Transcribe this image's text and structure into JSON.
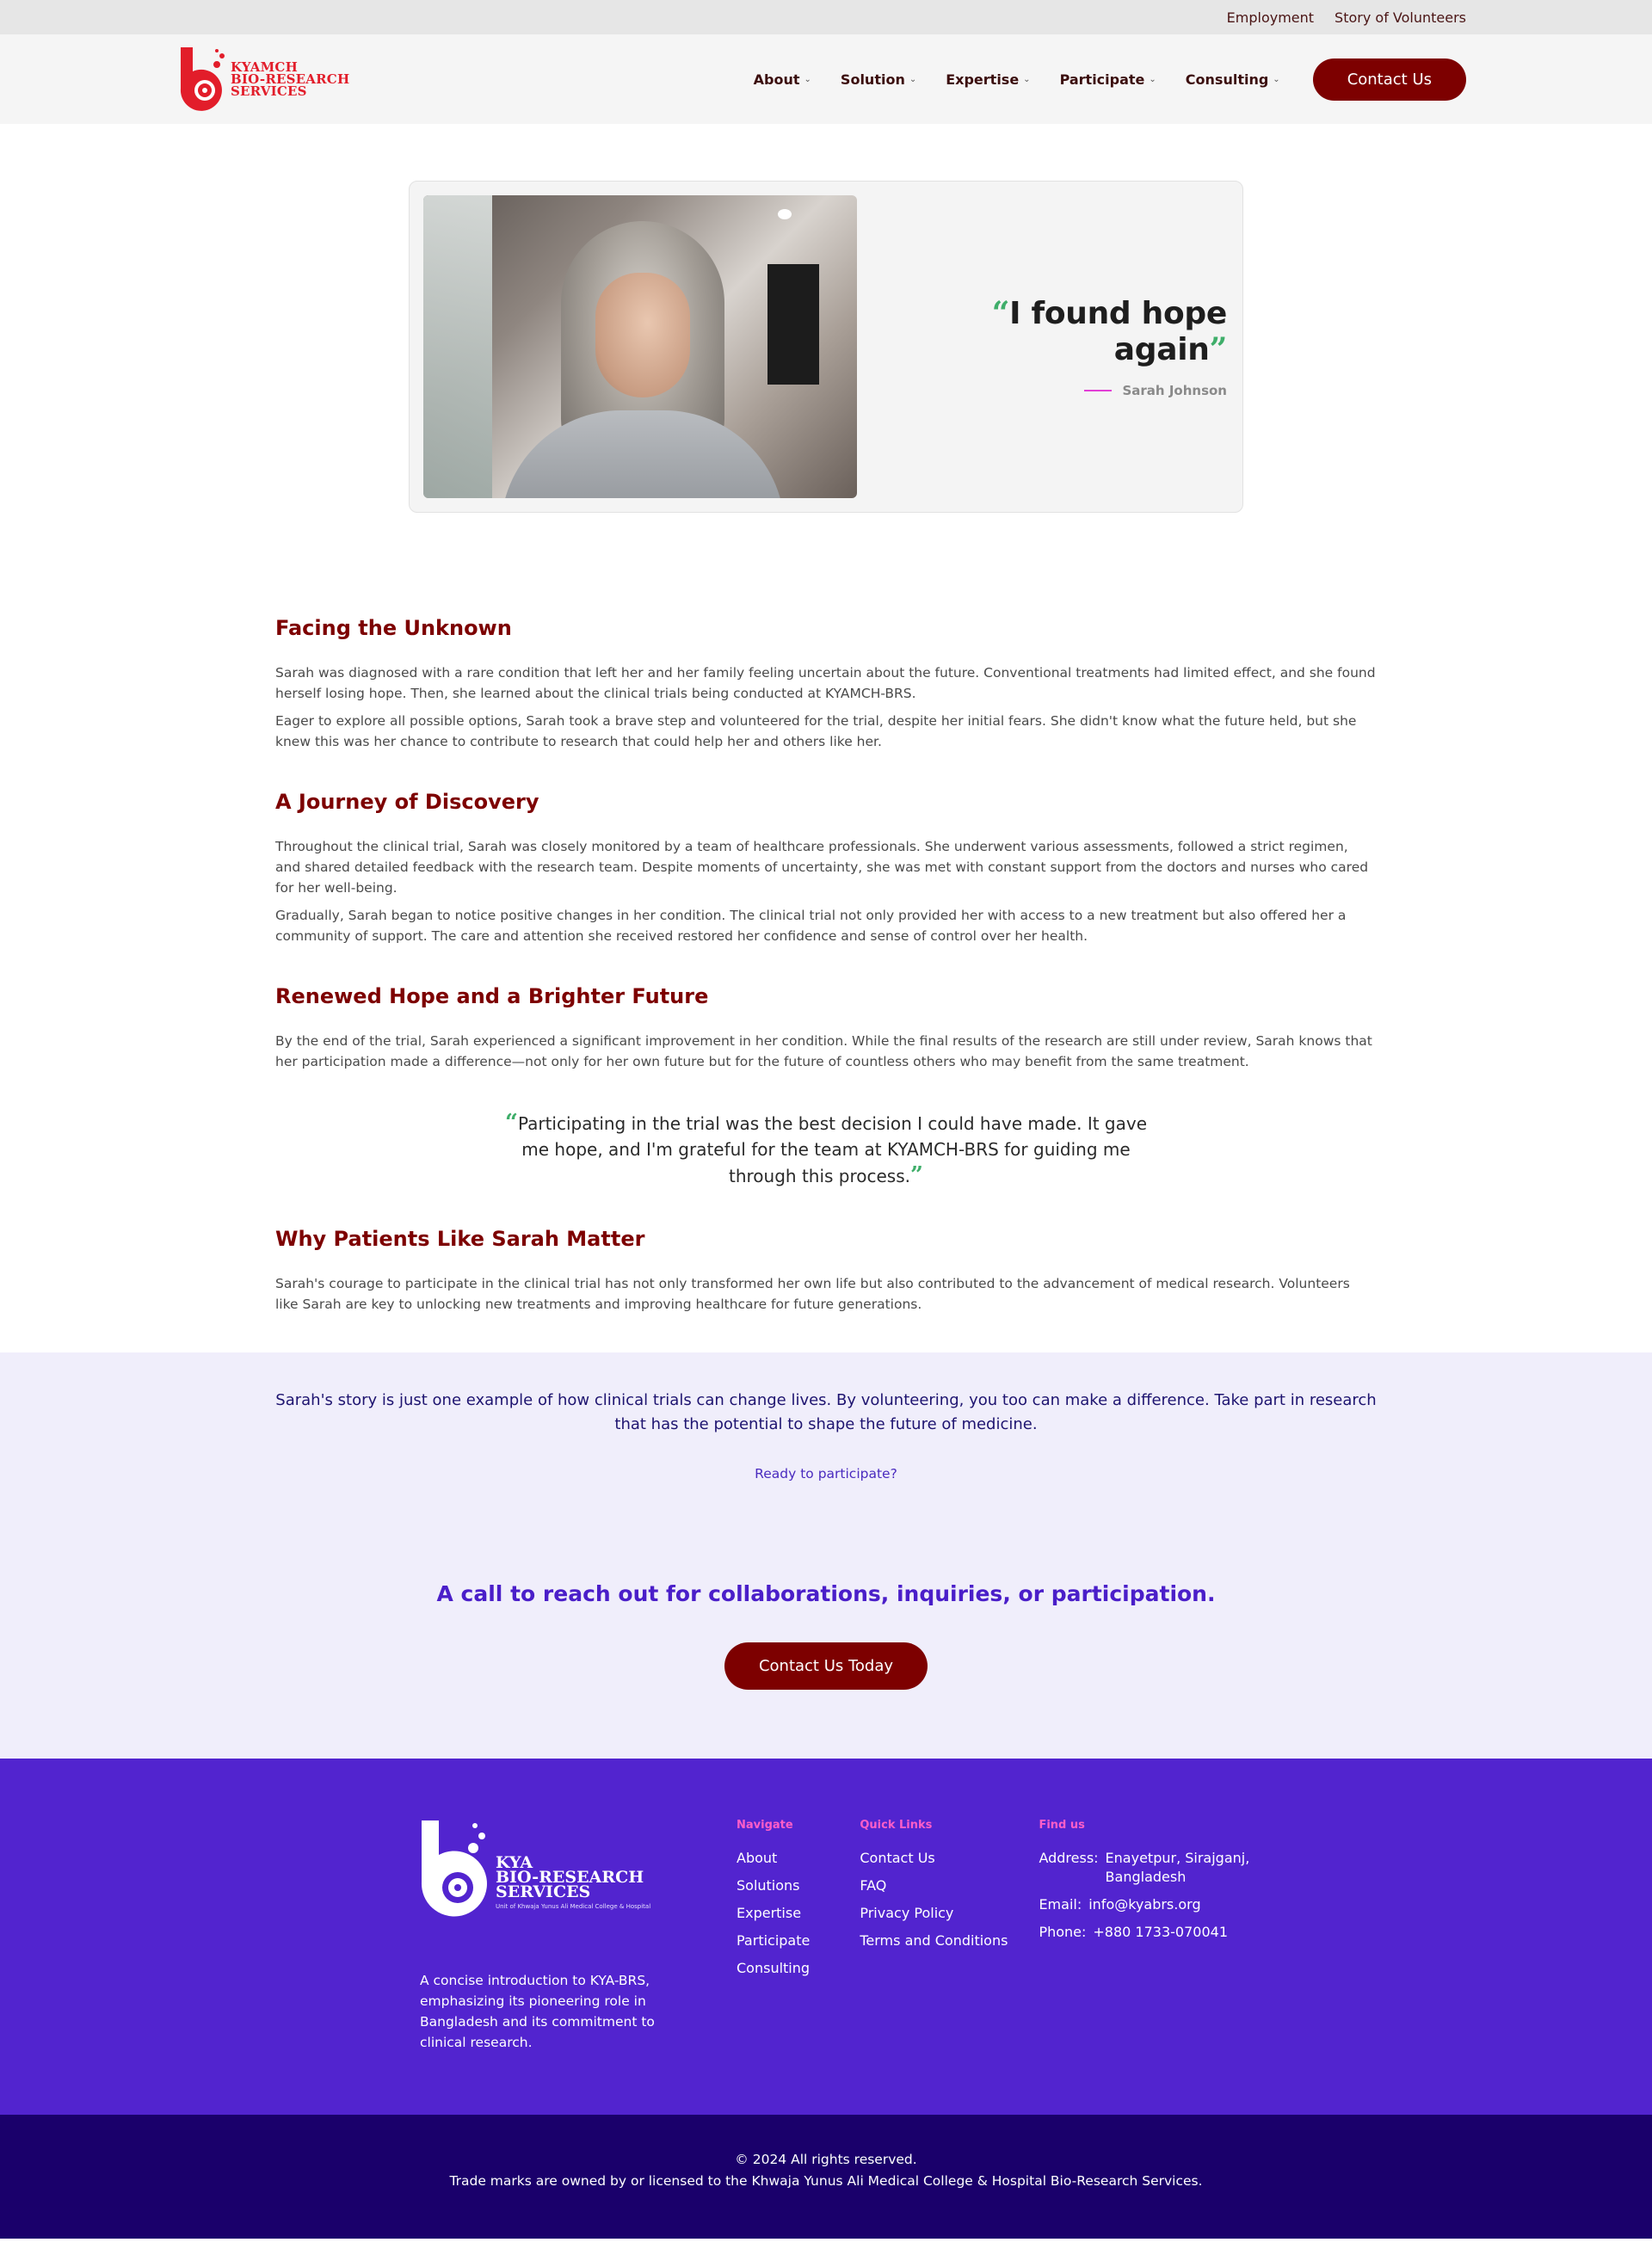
{
  "topbar": {
    "links": [
      "Employment",
      "Story of Volunteers"
    ]
  },
  "header": {
    "logo_lines": [
      "KYAMCH",
      "BIO-RESEARCH",
      "SERVICES"
    ],
    "nav": [
      {
        "label": "About"
      },
      {
        "label": "Solution"
      },
      {
        "label": "Expertise"
      },
      {
        "label": "Participate"
      },
      {
        "label": "Consulting"
      }
    ],
    "contact_label": "Contact Us"
  },
  "hero": {
    "quote": "I found hope again",
    "author": "Sarah Johnson"
  },
  "article": {
    "sections": [
      {
        "heading": "Facing the Unknown",
        "paragraphs": [
          "Sarah was diagnosed with a rare condition that left her and her family feeling uncertain about the future. Conventional treatments had limited effect, and she found herself losing hope. Then, she learned about the clinical trials being conducted at KYAMCH-BRS.",
          "Eager to explore all possible options, Sarah took a brave step and volunteered for the trial, despite her initial fears. She didn't know what the future held, but she knew this was her chance to contribute to research that could help her and others like her."
        ]
      },
      {
        "heading": "A Journey of Discovery",
        "paragraphs": [
          "Throughout the clinical trial, Sarah was closely monitored by a team of healthcare professionals. She underwent various assessments, followed a strict regimen, and shared detailed feedback with the research team. Despite moments of uncertainty, she was met with constant support from the doctors and nurses who cared for her well-being.",
          "Gradually, Sarah began to notice positive changes in her condition. The clinical trial not only provided her with access to a new treatment but also offered her a community of support. The care and attention she received restored her confidence and sense of control over her health."
        ]
      },
      {
        "heading": "Renewed Hope and a Brighter Future",
        "paragraphs": [
          "By the end of the trial, Sarah experienced a significant improvement in her condition. While the final results of the research are still under review, Sarah knows that her participation made a difference—not only for her own future but for the future of countless others who may benefit from the same treatment."
        ]
      }
    ],
    "pull_quote": "Participating in the trial was the best decision I could have made. It gave me hope, and I'm grateful for the team at KYAMCH-BRS for guiding me through this process.",
    "final_section": {
      "heading": "Why Patients Like Sarah Matter",
      "paragraphs": [
        "Sarah's courage to participate in the clinical trial has not only transformed her own life but also contributed to the advancement of medical research. Volunteers like Sarah are key to unlocking new treatments and improving healthcare for future generations."
      ]
    }
  },
  "cta": {
    "text": "Sarah's story is just one example of how clinical trials can change lives. By volunteering, you too can make a difference. Take part in research that has the potential to shape the future of medicine.",
    "link": "Ready to participate?",
    "heading": "A call to reach out for collaborations, inquiries, or participation.",
    "button": "Contact Us Today"
  },
  "footer": {
    "logo_lines": [
      "KYA",
      "BIO-RESEARCH",
      "SERVICES"
    ],
    "logo_sub": "Unit of Khwaja Yunus Ali Medical College & Hospital",
    "intro": "A concise introduction to KYA-BRS, emphasizing its pioneering role in Bangladesh and its commitment to clinical research.",
    "navigate": {
      "title": "Navigate",
      "items": [
        "About",
        "Solutions",
        "Expertise",
        "Participate",
        "Consulting"
      ]
    },
    "quick_links": {
      "title": "Quick Links",
      "items": [
        "Contact Us",
        "FAQ",
        "Privacy Policy",
        "Terms and Conditions"
      ]
    },
    "find_us": {
      "title": "Find us",
      "address_label": "Address:",
      "address_value": "Enayetpur, Sirajganj, Bangladesh",
      "email_label": "Email:",
      "email_value": "info@kyabrs.org",
      "phone_label": "Phone:",
      "phone_value": "+880 1733-070041"
    }
  },
  "bottom": {
    "copyright": "© 2024 All rights reserved.",
    "trademark": "Trade marks are owned by or licensed to the Khwaja Yunus Ali Medical College & Hospital Bio-Research Services."
  },
  "colors": {
    "brand_maroon": "#7d0000",
    "brand_red": "#e21d2a",
    "quote_green": "#3fae6a",
    "footer_purple": "#5224cf",
    "bottom_navy": "#1a006b",
    "accent_pink": "#ff5ec8"
  }
}
